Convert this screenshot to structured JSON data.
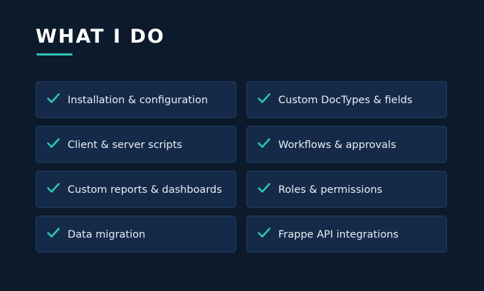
{
  "heading": "WHAT I DO",
  "colors": {
    "background": "#0c1a2c",
    "card": "#142a48",
    "card_border": "#213e61",
    "accent": "#2ec4b6",
    "text": "#e9eef5"
  },
  "icon": "check-icon",
  "items": [
    {
      "label": "Installation & configuration"
    },
    {
      "label": "Custom DocTypes & fields"
    },
    {
      "label": "Client & server scripts"
    },
    {
      "label": "Workflows & approvals"
    },
    {
      "label": "Custom reports & dashboards"
    },
    {
      "label": "Roles & permissions"
    },
    {
      "label": "Data migration"
    },
    {
      "label": "Frappe API integrations"
    }
  ]
}
